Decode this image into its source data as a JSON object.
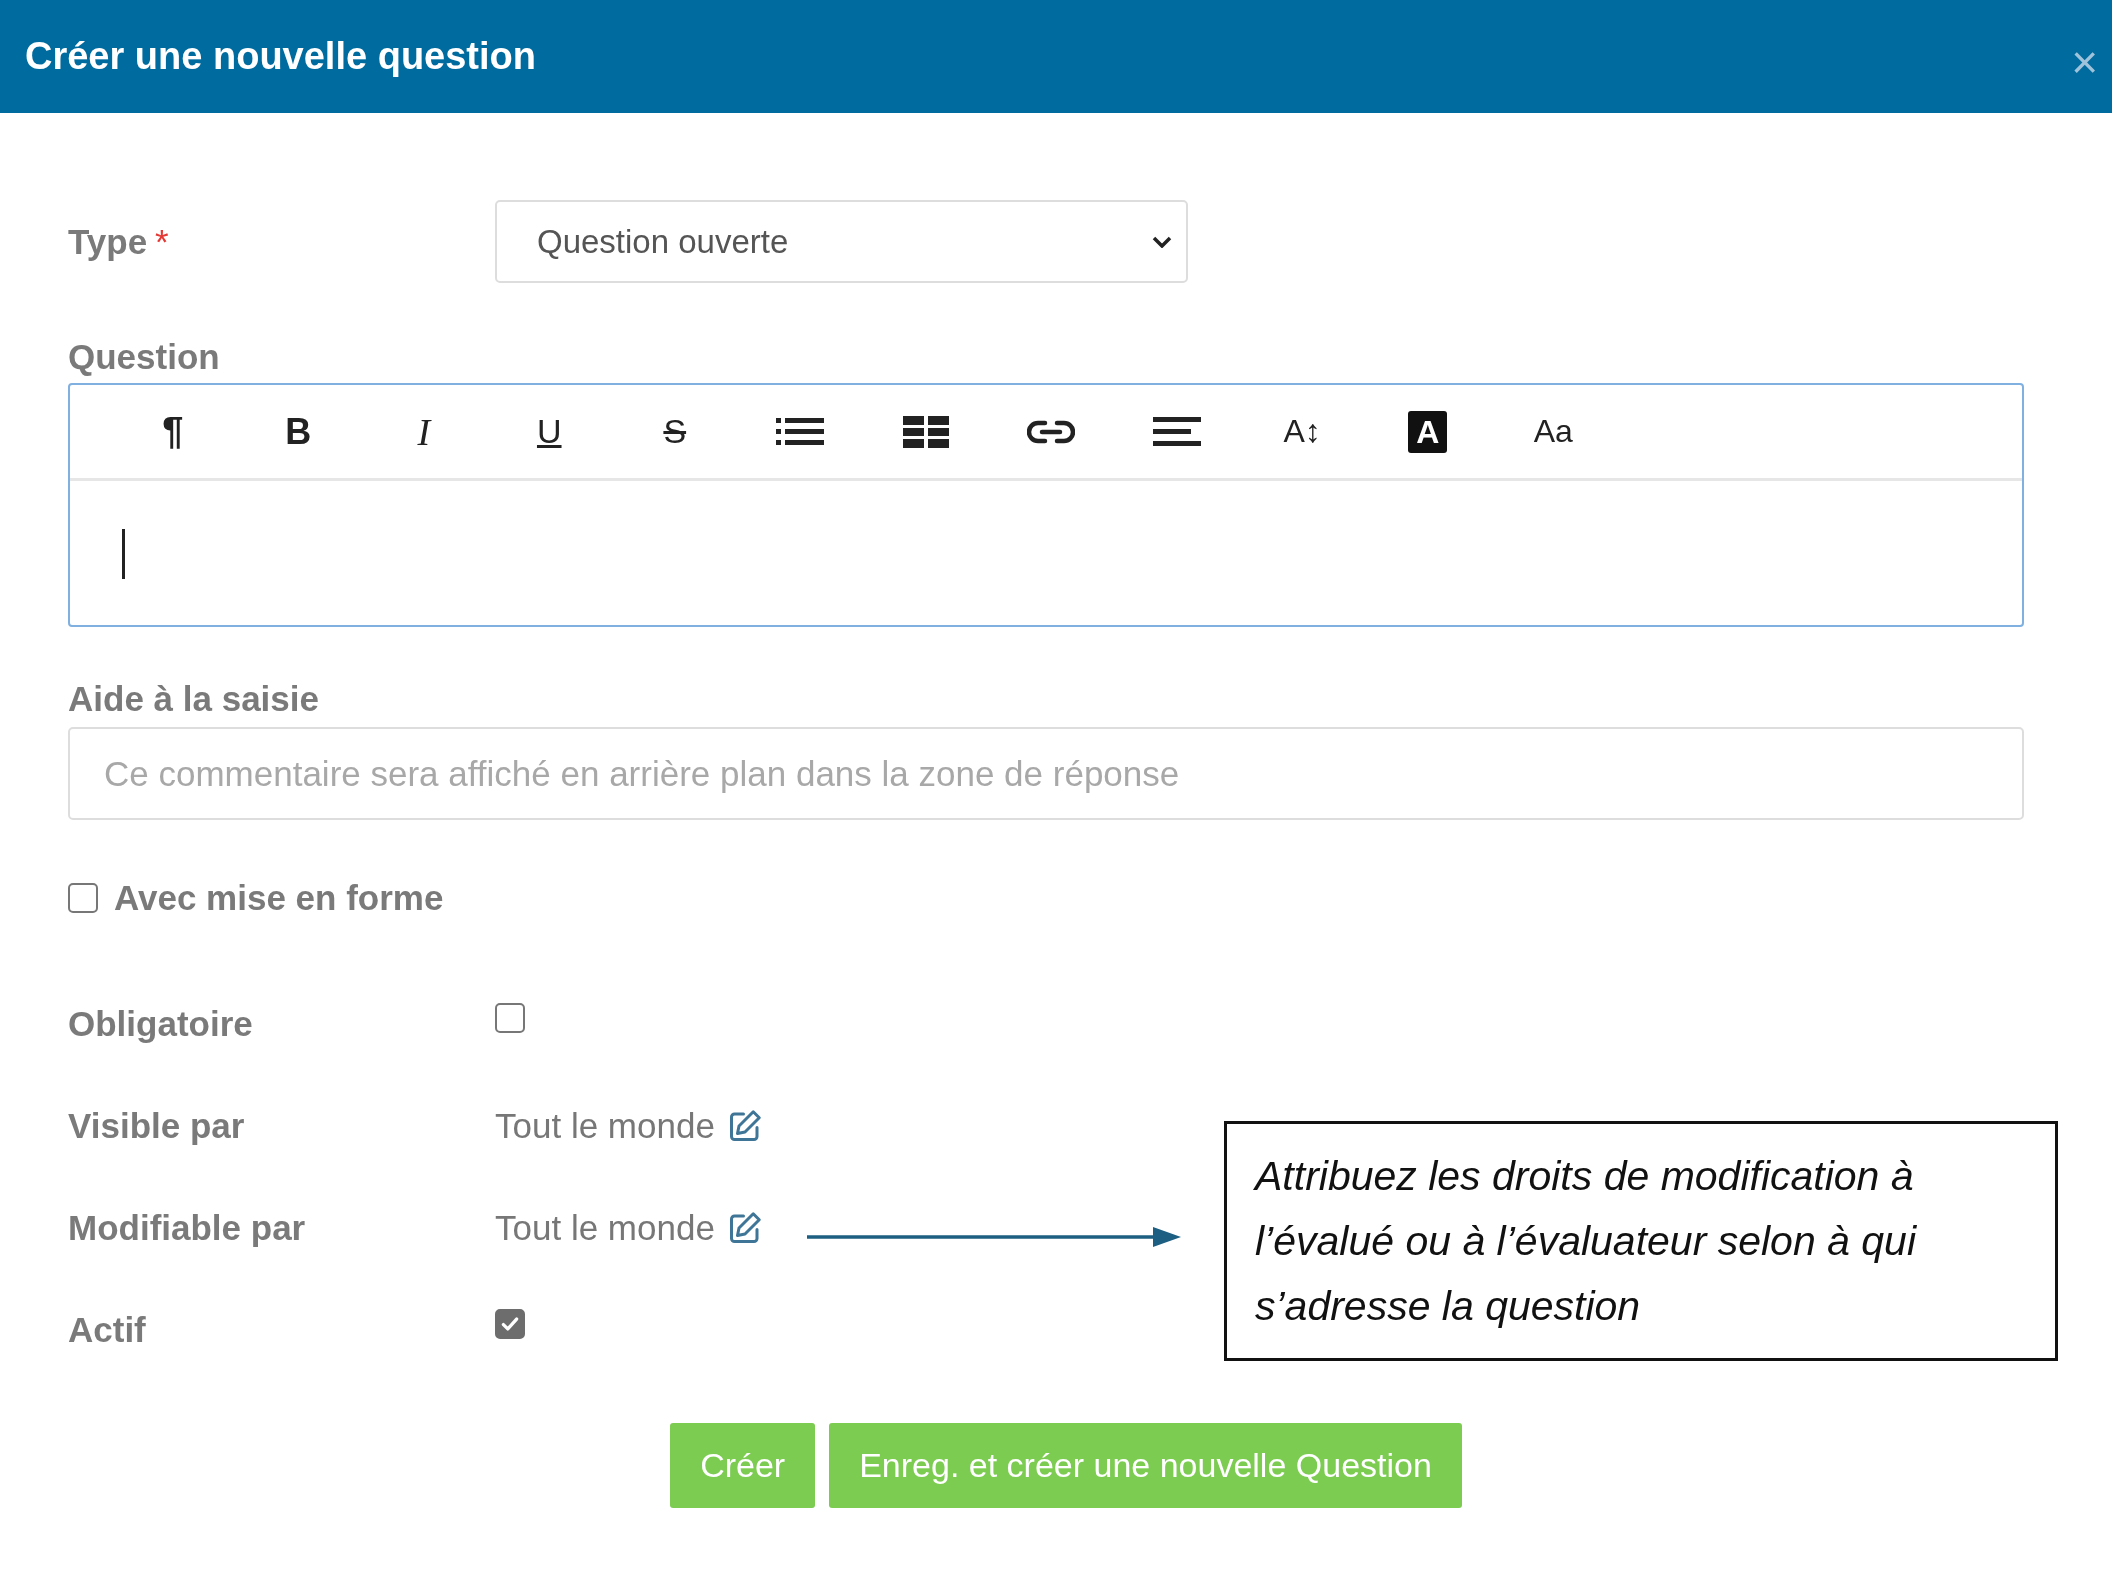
{
  "dialog": {
    "title": "Créer une nouvelle question",
    "close": "×"
  },
  "type_field": {
    "label": "Type",
    "required_mark": "*",
    "value": "Question ouverte"
  },
  "question": {
    "label": "Question",
    "toolbar": [
      {
        "kind": "paragraph",
        "glyph": "¶"
      },
      {
        "kind": "bold",
        "glyph": "B"
      },
      {
        "kind": "italic",
        "glyph": "I"
      },
      {
        "kind": "underline",
        "glyph": "U"
      },
      {
        "kind": "strike",
        "glyph": "S"
      },
      {
        "kind": "list"
      },
      {
        "kind": "table"
      },
      {
        "kind": "link"
      },
      {
        "kind": "align"
      },
      {
        "kind": "size",
        "glyph": "A↕"
      },
      {
        "kind": "inverse",
        "glyph": "A"
      },
      {
        "kind": "case",
        "glyph": "Aa"
      }
    ]
  },
  "hint": {
    "label": "Aide à la saisie",
    "placeholder": "Ce commentaire sera affiché en arrière plan dans la zone de réponse"
  },
  "formatting": {
    "label": "Avec mise en forme",
    "checked": false
  },
  "fields": [
    {
      "kind": "checkbox",
      "label": "Obligatoire",
      "checked": false
    },
    {
      "kind": "link",
      "label": "Visible par",
      "value": "Tout le monde"
    },
    {
      "kind": "link",
      "label": "Modifiable par",
      "value": "Tout le monde"
    },
    {
      "kind": "checkbox",
      "label": "Actif",
      "checked": true
    }
  ],
  "note": {
    "text": "Attribuez les droits de modification à l’évalué ou à l’évaluateur selon à qui s’adresse la question"
  },
  "buttons": [
    "Créer",
    "Enreg. et créer une nouvelle Question"
  ]
}
